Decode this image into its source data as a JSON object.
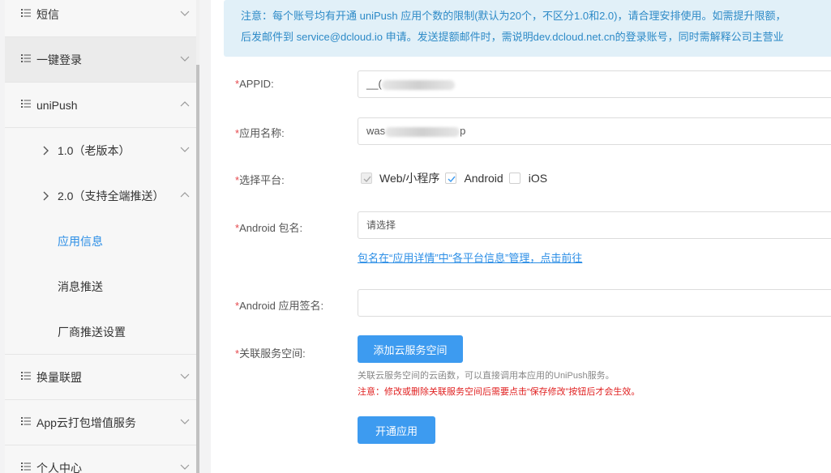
{
  "sidebar": {
    "items": [
      {
        "label": "短信",
        "expanded": false
      },
      {
        "label": "一键登录",
        "expanded": false
      },
      {
        "label": "uniPush",
        "expanded": true
      },
      {
        "label": "1.0（老版本）",
        "expanded": false
      },
      {
        "label": "2.0（支持全端推送）",
        "expanded": true
      },
      {
        "label": "应用信息",
        "selected": true
      },
      {
        "label": "消息推送"
      },
      {
        "label": "厂商推送设置"
      },
      {
        "label": "换量联盟",
        "expanded": false
      },
      {
        "label": "App云打包增值服务",
        "expanded": false
      },
      {
        "label": "个人中心",
        "expanded": false
      }
    ]
  },
  "notice": {
    "line1": "注意：每个账号均有开通 uniPush 应用个数的限制(默认为20个，不区分1.0和2.0)，请合理安排使用。如需提升限额，",
    "line2": "后发邮件到 service@dcloud.io 申请。发送提额邮件时，需说明dev.dcloud.net.cn的登录账号，同时需解释公司主营业"
  },
  "form": {
    "appid": {
      "label": "APPID:",
      "value_prefix": "__("
    },
    "app_name": {
      "label": "应用名称:",
      "value_prefix": "was",
      "value_suffix": "p"
    },
    "platform": {
      "label": "选择平台:",
      "options": [
        {
          "label": "Web/小程序",
          "checked": true,
          "disabled": true
        },
        {
          "label": "Android",
          "checked": true,
          "disabled": false
        },
        {
          "label": "iOS",
          "checked": false,
          "disabled": false
        }
      ]
    },
    "android_package": {
      "label": "Android 包名:",
      "placeholder": "请选择",
      "link": "包名在“应用详情”中“各平台信息”管理，点击前往"
    },
    "android_sign": {
      "label": "Android 应用签名:",
      "value": ""
    },
    "service_space": {
      "label": "关联服务空间:",
      "button": "添加云服务空间",
      "hint": "关联云服务空间的云函数，可以直接调用本应用的UniPush服务。",
      "warning": "注意：修改或删除关联服务空间后需要点击“保存修改”按钮后才会生效。"
    },
    "required_mark": "*",
    "submit": "开通应用"
  },
  "colors": {
    "accent": "#3d9bf0",
    "link": "#2b8ee6",
    "notice_bg": "#e1f0f8",
    "notice_text": "#2d8ac7",
    "required": "#e5484d",
    "warning": "#e02020"
  }
}
